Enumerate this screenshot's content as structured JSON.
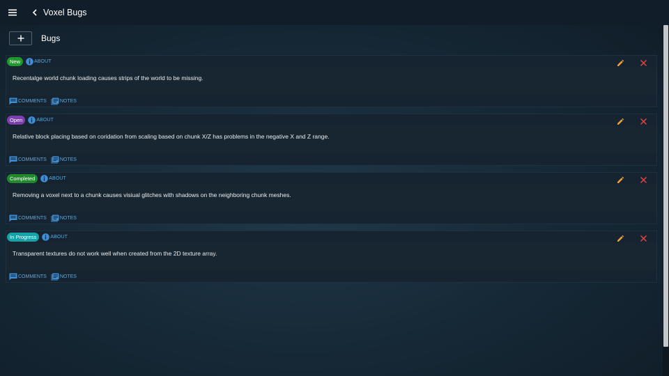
{
  "header": {
    "title": "Voxel Bugs",
    "menu_icon": "menu-icon",
    "back_icon": "chevron-left-icon"
  },
  "toolbar": {
    "add_icon": "plus-icon",
    "section_title": "Bugs"
  },
  "labels": {
    "about": "ABOUT",
    "comments": "COMMENTS",
    "notes": "NOTES"
  },
  "colors": {
    "new": "#1e9a2b",
    "open": "#7e3fae",
    "completed": "#1f8a2c",
    "in_progress": "#15a3a8",
    "info": "#3f8fd6",
    "edit": "#f0a437",
    "delete": "#e04444",
    "link": "#5aa8e0"
  },
  "bugs": [
    {
      "status": "New",
      "status_color": "#1e9a2b",
      "description": "Recentalge world chunk loading causes strips of the world to be missing."
    },
    {
      "status": "Open",
      "status_color": "#7e3fae",
      "description": "Relative block placing based on coridation from scaling based on chunk X/Z has problems in the negative X and Z range."
    },
    {
      "status": "Completed",
      "status_color": "#1f8a2c",
      "description": "Removing a voxel next to a chunk causes visiual glitches with shadows on the neighboring chunk meshes."
    },
    {
      "status": "In Progress",
      "status_color": "#15a3a8",
      "description": "Transparent textures do not work well when created from the 2D texture array."
    }
  ]
}
